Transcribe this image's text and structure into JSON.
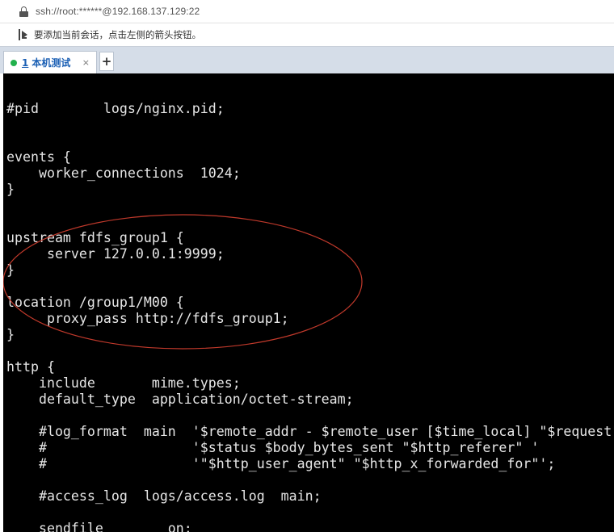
{
  "address_bar": {
    "icon": "lock-icon",
    "url": "ssh://root:******@192.168.137.129:22"
  },
  "hint_bar": {
    "icon": "arrow-right-icon",
    "text": "要添加当前会话，点击左侧的箭头按钮。"
  },
  "tabs": [
    {
      "number": "1",
      "label": "本机测试",
      "status_color": "#22b14c",
      "close": "×"
    }
  ],
  "new_tab_label": "+",
  "terminal": {
    "lines": [
      "",
      "#pid        logs/nginx.pid;",
      "",
      "",
      "events {",
      "    worker_connections  1024;",
      "}",
      "",
      "",
      "upstream fdfs_group1 {",
      "     server 127.0.0.1:9999;",
      "}",
      "",
      "location /group1/M00 {",
      "     proxy_pass http://fdfs_group1;",
      "}",
      "",
      "http {",
      "    include       mime.types;",
      "    default_type  application/octet-stream;",
      "",
      "    #log_format  main  '$remote_addr - $remote_user [$time_local] \"$request\" '",
      "    #                  '$status $body_bytes_sent \"$http_referer\" '",
      "    #                  '\"$http_user_agent\" \"$http_x_forwarded_for\"';",
      "",
      "    #access_log  logs/access.log  main;",
      "",
      "    sendfile        on;"
    ],
    "annotation_color": "#c0392b"
  }
}
